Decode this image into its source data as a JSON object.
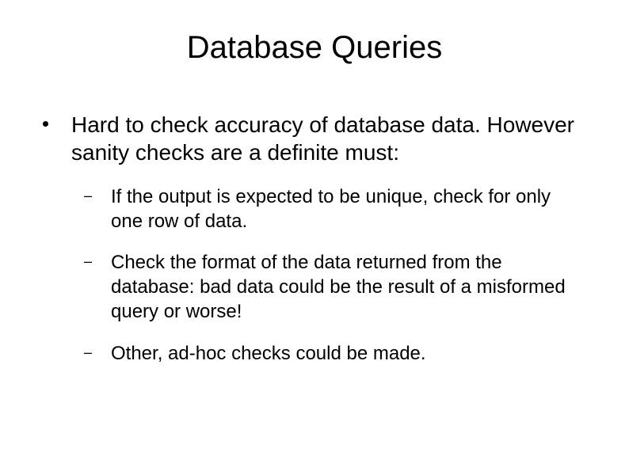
{
  "title": "Database Queries",
  "bullets": [
    {
      "text": "Hard to check accuracy of database data. However sanity checks are a definite must:",
      "sub": [
        "If the output is expected to be unique, check for only one row of data.",
        "Check the format of the data returned from the database: bad data could be the result of a misformed query or worse!",
        "Other, ad-hoc checks could be made."
      ]
    }
  ]
}
